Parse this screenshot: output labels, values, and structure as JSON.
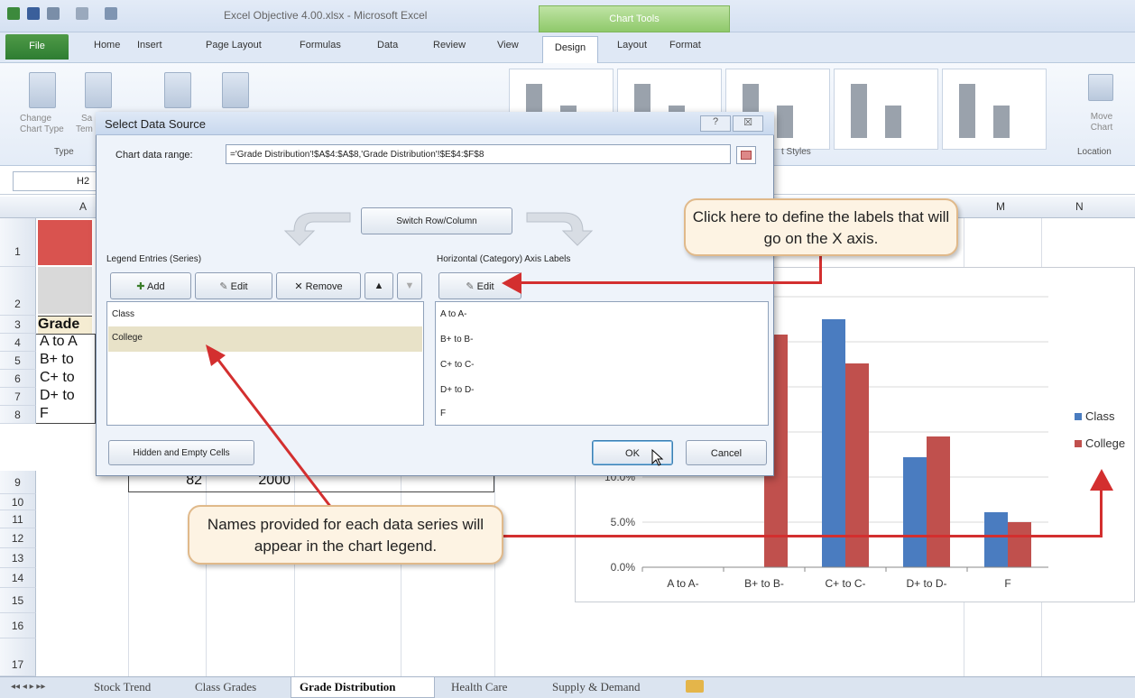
{
  "window": {
    "title": "Excel Objective 4.00.xlsx - Microsoft Excel",
    "context_tab": "Chart Tools"
  },
  "ribbon": {
    "tabs": [
      "File",
      "Home",
      "Insert",
      "Page Layout",
      "Formulas",
      "Data",
      "Review",
      "View",
      "Design",
      "Layout",
      "Format"
    ],
    "groups": {
      "type": "Type",
      "chart_styles": "t Styles",
      "location": "Location"
    },
    "buttons": {
      "change_chart_type": "Change Chart Type",
      "save_template_partial": "Sa",
      "template_partial": "Tem",
      "move_chart": "Move Chart"
    }
  },
  "formula": {
    "name_box": "H2"
  },
  "grid": {
    "columns": [
      "A",
      "M",
      "N"
    ],
    "rows": [
      "1",
      "2",
      "3",
      "4",
      "5",
      "6",
      "7",
      "8",
      "9",
      "10",
      "11",
      "12",
      "13",
      "14",
      "15",
      "16",
      "17"
    ],
    "cells": {
      "a3": "Grade",
      "a4": "A to A",
      "a5": "B+ to",
      "a6": "C+ to",
      "a7": "D+ to",
      "a8": "F",
      "b9": "82",
      "c9": "2000"
    }
  },
  "dialog": {
    "title": "Select Data Source",
    "help": "?",
    "close": "☒",
    "range_label": "Chart data range:",
    "range_value": "='Grade Distribution'!$A$4:$A$8,'Grade Distribution'!$E$4:$F$8",
    "switch_label": "Switch Row/Column",
    "legend_label": "Legend Entries (Series)",
    "axis_label": "Horizontal (Category) Axis Labels",
    "add": "Add",
    "edit": "Edit",
    "remove": "Remove",
    "axis_edit": "Edit",
    "series": [
      "Class",
      "College"
    ],
    "categories": [
      "A to A-",
      "B+ to B-",
      "C+ to C-",
      "D+ to D-",
      "F"
    ],
    "hidden_cells": "Hidden and Empty Cells",
    "ok": "OK",
    "cancel": "Cancel"
  },
  "callouts": {
    "axis": "Click here to define the labels that will go on the X axis.",
    "series": "Names provided for each data series will appear in the chart legend."
  },
  "chart_data": {
    "type": "bar",
    "categories": [
      "A to A-",
      "B+ to B-",
      "C+ to C-",
      "D+ to D-",
      "F"
    ],
    "series": [
      {
        "name": "Class",
        "values": [
          null,
          null,
          0.275,
          0.122,
          0.061
        ],
        "color": "#4a7cc0"
      },
      {
        "name": "College",
        "values": [
          null,
          0.258,
          0.226,
          0.145,
          0.05
        ],
        "color": "#c0504d"
      }
    ],
    "yticks": [
      "0.0%",
      "5.0%",
      "10.0%"
    ],
    "ylim": [
      0,
      0.3
    ],
    "legend": "right"
  },
  "sheets": {
    "tabs": [
      "Stock Trend",
      "Class Grades",
      "Grade Distribution",
      "Health Care",
      "Supply & Demand"
    ],
    "active": "Grade Distribution"
  },
  "colors": {
    "accent_red": "#d32f2f",
    "chart_tools_green": "#8fc96b",
    "grade_header_red": "#d9534f"
  }
}
